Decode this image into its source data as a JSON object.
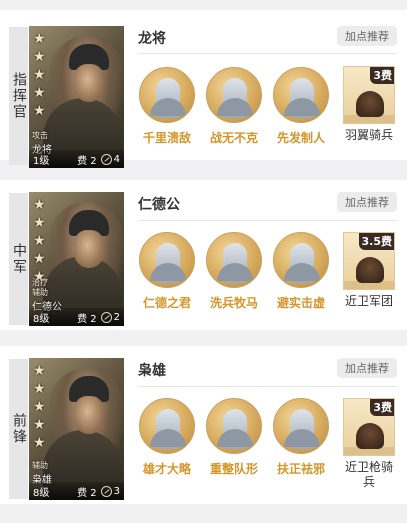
{
  "cards": [
    {
      "role": "指挥官",
      "hero": {
        "name": "龙将",
        "tags": [
          "攻击",
          "龙将"
        ],
        "level": "1级",
        "cost_label": "费",
        "cost": "2",
        "badge_value": "4",
        "stars": 5
      },
      "title": "龙将",
      "recommend_label": "加点推荐",
      "skills": [
        {
          "name": "千里溃敌",
          "icon": "mounted-warrior-skill-icon"
        },
        {
          "name": "战无不克",
          "icon": "crossed-weapons-skill-icon"
        },
        {
          "name": "先发制人",
          "icon": "spear-skill-icon"
        }
      ],
      "troop": {
        "name": "羽翼骑兵",
        "cost": "3费",
        "icon": "cavalry-troop-icon"
      }
    },
    {
      "role": "中军",
      "hero": {
        "name": "仁德公",
        "tags": [
          "治疗",
          "辅助"
        ],
        "level": "8级",
        "cost_label": "费",
        "cost": "2",
        "badge_value": "2",
        "stars": 5
      },
      "title": "仁德公",
      "recommend_label": "加点推荐",
      "skills": [
        {
          "name": "仁德之君",
          "icon": "lord-skill-icon"
        },
        {
          "name": "洗兵牧马",
          "icon": "warrior-skill-icon"
        },
        {
          "name": "避实击虚",
          "icon": "kneeling-soldier-skill-icon"
        }
      ],
      "troop": {
        "name": "近卫军团",
        "cost": "3.5费",
        "icon": "guard-troop-icon"
      }
    },
    {
      "role": "前锋",
      "hero": {
        "name": "枭雄",
        "tags": [
          "辅助"
        ],
        "level": "8级",
        "cost_label": "费",
        "cost": "2",
        "badge_value": "3",
        "stars": 5
      },
      "title": "枭雄",
      "recommend_label": "加点推荐",
      "skills": [
        {
          "name": "雄才大略",
          "icon": "general-skill-icon"
        },
        {
          "name": "重整队形",
          "icon": "formation-skill-icon"
        },
        {
          "name": "扶正祛邪",
          "icon": "shouting-warrior-skill-icon"
        }
      ],
      "troop": {
        "name": "近卫枪骑兵",
        "cost": "3费",
        "icon": "lancer-troop-icon"
      }
    }
  ]
}
